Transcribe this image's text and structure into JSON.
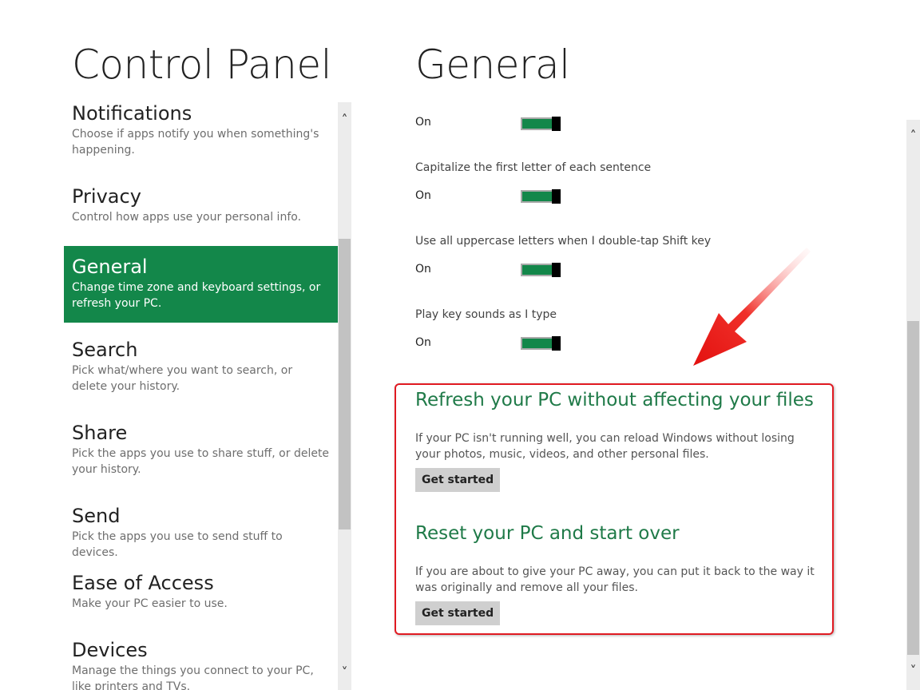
{
  "app": {
    "title": "Control Panel"
  },
  "nav": {
    "items": [
      {
        "label": "Notifications",
        "desc": "Choose if apps notify you when something's happening."
      },
      {
        "label": "Privacy",
        "desc": "Control how apps use your personal info."
      },
      {
        "label": "General",
        "desc": "Change time zone and keyboard settings, or refresh your PC.",
        "selected": true
      },
      {
        "label": "Search",
        "desc": "Pick what/where you want to search, or delete your history."
      },
      {
        "label": "Share",
        "desc": "Pick the apps you use to share stuff, or delete your history."
      },
      {
        "label": "Send",
        "desc": "Pick the apps you use to send stuff to devices."
      },
      {
        "label": "Ease of Access",
        "desc": "Make your PC easier to use."
      },
      {
        "label": "Devices",
        "desc": "Manage the things you connect to your PC, like printers and TVs."
      }
    ]
  },
  "page": {
    "title": "General",
    "settings": [
      {
        "label": "",
        "state": "On",
        "on": true
      },
      {
        "label": "Capitalize the first letter of each sentence",
        "state": "On",
        "on": true
      },
      {
        "label": "Use all uppercase letters when I double-tap Shift key",
        "state": "On",
        "on": true
      },
      {
        "label": "Play key sounds as I type",
        "state": "On",
        "on": true
      }
    ],
    "refresh": {
      "heading": "Refresh your PC without affecting your files",
      "desc": "If your PC isn't running well, you can reload Windows without losing your photos, music, videos, and other personal files.",
      "button": "Get started"
    },
    "reset": {
      "heading": "Reset your PC and start over",
      "desc": "If you are about to give your PC away, you can put it back to the way it was originally and remove all your files.",
      "button": "Get started"
    }
  },
  "colors": {
    "accent": "#13874a",
    "heading_green": "#1f7a48",
    "annotation_red": "#e01a22"
  },
  "icons": {
    "scroll_up": "chevron-up-icon",
    "scroll_down": "chevron-down-icon",
    "annotation": "red-arrow-icon"
  }
}
